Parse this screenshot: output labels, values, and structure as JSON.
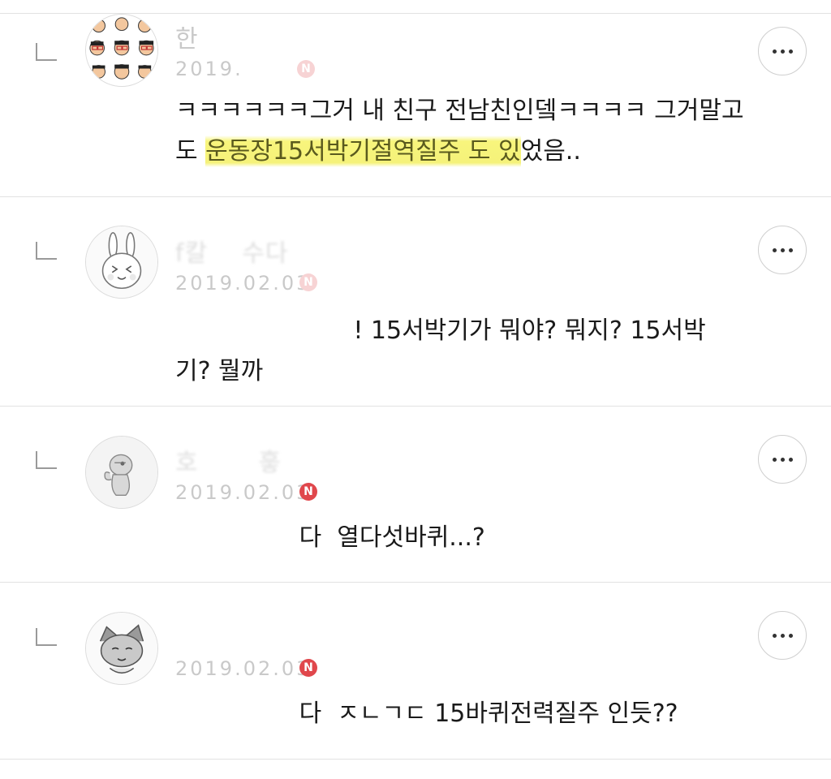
{
  "comments": [
    {
      "author": "한",
      "date": "2019.",
      "badge": "N",
      "text_line1": "ㅋㅋㅋㅋㅋㅋ그거 내 친구 전남친인뎈ㅋㅋㅋㅋ 그거말고",
      "text_line2_prefix": "도 ",
      "text_line2_highlight": "운동장15서박기절역질주 도 있",
      "text_line2_suffix": "었음.."
    },
    {
      "author": "f칼",
      "author_suffix": "수다",
      "date": "2019.02.03",
      "badge": "N",
      "text_line1_mention": "",
      "text_line1": "! 15서박기가 뭐야? 뭐지? 15서박",
      "text_line2": "기? 뭘까"
    },
    {
      "author": "호",
      "author_suffix": "흫",
      "date": "2019.02.03",
      "badge": "N",
      "text_mention_suffix": "다",
      "text": "열다섯바퀴...?"
    },
    {
      "author": "",
      "date": "2019.02.03",
      "badge": "N",
      "text_mention_suffix": "다",
      "text": "ㅈㄴㄱㄷ 15바퀴전력질주 인듯??"
    }
  ],
  "more_icon": "more-horizontal-icon",
  "colors": {
    "highlight": "#f5f27a",
    "badge": "#e0474c",
    "divider": "#e2e2e2"
  }
}
